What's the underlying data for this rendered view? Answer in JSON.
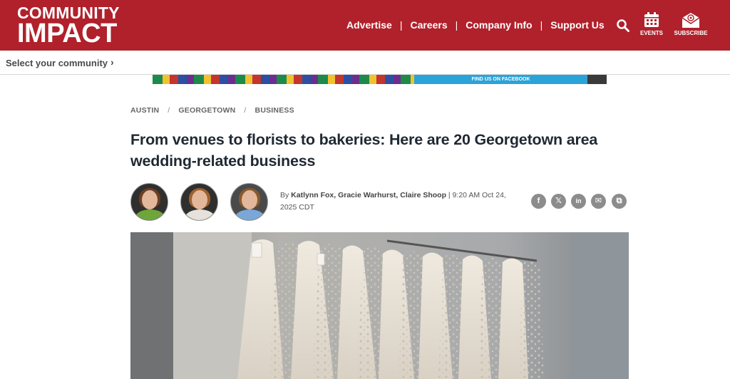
{
  "header": {
    "logo_line1": "COMMUNITY",
    "logo_line2": "IMPACT",
    "nav": [
      "Advertise",
      "Careers",
      "Company Info",
      "Support Us"
    ],
    "nav_separator": "|",
    "events_label": "EVENTS",
    "subscribe_label": "SUBSCRIBE",
    "brand_color": "#b0212b"
  },
  "community_bar": {
    "label": "Select your community",
    "chevron": "›"
  },
  "ad": {
    "text": "FIND US ON FACEBOOK"
  },
  "article": {
    "breadcrumbs": [
      "AUSTIN",
      "GEORGETOWN",
      "BUSINESS"
    ],
    "breadcrumb_separator": "/",
    "headline": "From venues to florists to bakeries: Here are 20 Georgetown area wedding-related business",
    "byline_prefix": "By ",
    "authors": "Katlynn Fox, Gracie Warhurst, Claire Shoop",
    "timestamp": " | 9:20 AM Oct 24, 2025 CDT"
  },
  "share_icons": [
    "facebook-icon",
    "x-icon",
    "linkedin-icon",
    "email-icon",
    "copy-link-icon"
  ],
  "share_glyphs": [
    "f",
    "𝕏",
    "in",
    "✉",
    "⧉"
  ]
}
